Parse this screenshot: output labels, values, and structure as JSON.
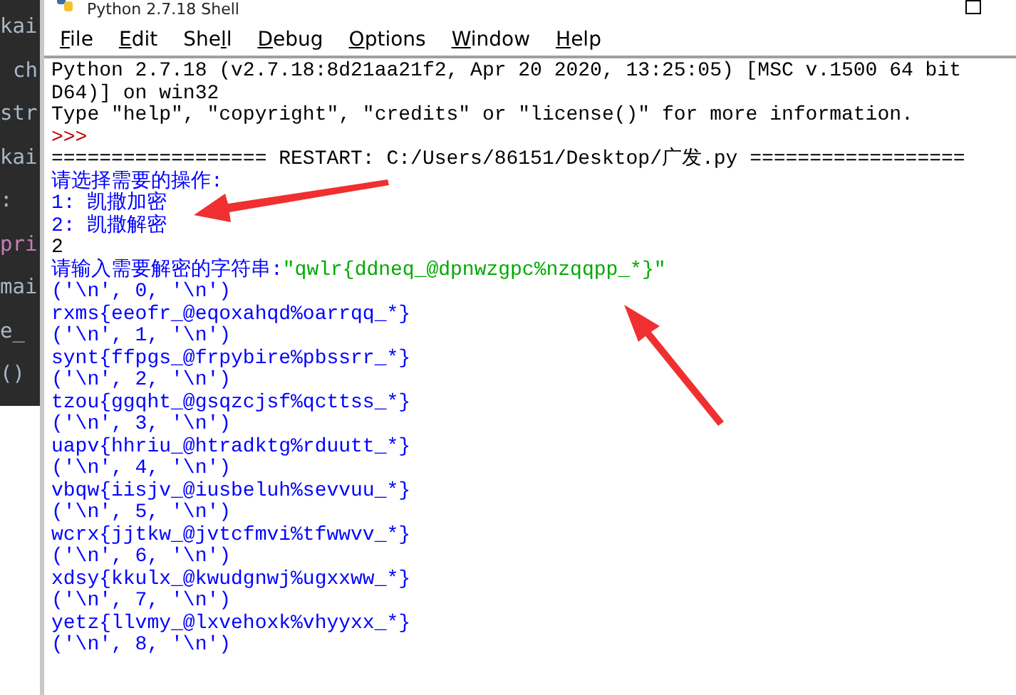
{
  "background_editor": {
    "lines": [
      {
        "text": "kai",
        "indent": false,
        "color": "#a9b7c6"
      },
      {
        "text": "ch",
        "indent": true,
        "color": "#a9b7c6"
      },
      {
        "text": "str",
        "indent": false,
        "color": "#a9b7c6"
      },
      {
        "text": "kai",
        "indent": false,
        "color": "#a9b7c6"
      },
      {
        "text": ":",
        "indent": false,
        "color": "#a9b7c6"
      },
      {
        "text": "pri",
        "indent": false,
        "color": "#c77dbb"
      },
      {
        "text": "mai",
        "indent": false,
        "color": "#a9b7c6"
      },
      {
        "text": "e_",
        "indent": false,
        "color": "#a9b7c6"
      },
      {
        "text": "()",
        "indent": false,
        "color": "#a9b7c6"
      }
    ]
  },
  "window": {
    "title": "Python 2.7.18 Shell"
  },
  "menu": [
    {
      "mnemonic": "F",
      "after": "ile"
    },
    {
      "mnemonic": "E",
      "after": "dit"
    },
    {
      "before": "She",
      "mnemonic": "l",
      "after": "l"
    },
    {
      "mnemonic": "D",
      "after": "ebug"
    },
    {
      "mnemonic": "O",
      "after": "ptions"
    },
    {
      "mnemonic": "W",
      "after": "indow"
    },
    {
      "mnemonic": "H",
      "after": "elp"
    }
  ],
  "shell_lines": [
    [
      {
        "kind": "info",
        "text": "Python 2.7.18 (v2.7.18:8d21aa21f2, Apr 20 2020, 13:25:05) [MSC v.1500 64 bit"
      }
    ],
    [
      {
        "kind": "info",
        "text": "D64)] on win32"
      }
    ],
    [
      {
        "kind": "info",
        "text": "Type \"help\", \"copyright\", \"credits\" or \"license()\" for more information."
      }
    ],
    [
      {
        "kind": "prompt",
        "text": ">>>"
      }
    ],
    [
      {
        "kind": "info",
        "text": "================== RESTART: C:/Users/86151/Desktop/广发.py =================="
      }
    ],
    [
      {
        "kind": "output",
        "text": "请选择需要的操作:"
      }
    ],
    [
      {
        "kind": "output",
        "text": "1: 凯撒加密"
      }
    ],
    [
      {
        "kind": "output",
        "text": "2: 凯撒解密"
      }
    ],
    [
      {
        "kind": "input",
        "text": "2"
      }
    ],
    [
      {
        "kind": "output",
        "text": "请输入需要解密的字符串:"
      },
      {
        "kind": "string",
        "text": "\"qwlr{ddneq_@dpnwzgpc%nzqqpp_*}\""
      }
    ],
    [
      {
        "kind": "output",
        "text": "('\\n', 0, '\\n')"
      }
    ],
    [
      {
        "kind": "output",
        "text": "rxms{eeofr_@eqoxahqd%oarrqq_*}"
      }
    ],
    [
      {
        "kind": "output",
        "text": "('\\n', 1, '\\n')"
      }
    ],
    [
      {
        "kind": "output",
        "text": "synt{ffpgs_@frpybire%pbssrr_*}"
      }
    ],
    [
      {
        "kind": "output",
        "text": "('\\n', 2, '\\n')"
      }
    ],
    [
      {
        "kind": "output",
        "text": "tzou{ggqht_@gsqzcjsf%qcttss_*}"
      }
    ],
    [
      {
        "kind": "output",
        "text": "('\\n', 3, '\\n')"
      }
    ],
    [
      {
        "kind": "output",
        "text": "uapv{hhriu_@htradktg%rduutt_*}"
      }
    ],
    [
      {
        "kind": "output",
        "text": "('\\n', 4, '\\n')"
      }
    ],
    [
      {
        "kind": "output",
        "text": "vbqw{iisjv_@iusbeluh%sevvuu_*}"
      }
    ],
    [
      {
        "kind": "output",
        "text": "('\\n', 5, '\\n')"
      }
    ],
    [
      {
        "kind": "output",
        "text": "wcrx{jjtkw_@jvtcfmvi%tfwwvv_*}"
      }
    ],
    [
      {
        "kind": "output",
        "text": "('\\n', 6, '\\n')"
      }
    ],
    [
      {
        "kind": "output",
        "text": "xdsy{kkulx_@kwudgnwj%ugxxww_*}"
      }
    ],
    [
      {
        "kind": "output",
        "text": "('\\n', 7, '\\n')"
      }
    ],
    [
      {
        "kind": "output",
        "text": "yetz{llvmy_@lxvehoxk%vhyyxx_*}"
      }
    ],
    [
      {
        "kind": "output",
        "text": "('\\n', 8, '\\n')"
      }
    ]
  ]
}
